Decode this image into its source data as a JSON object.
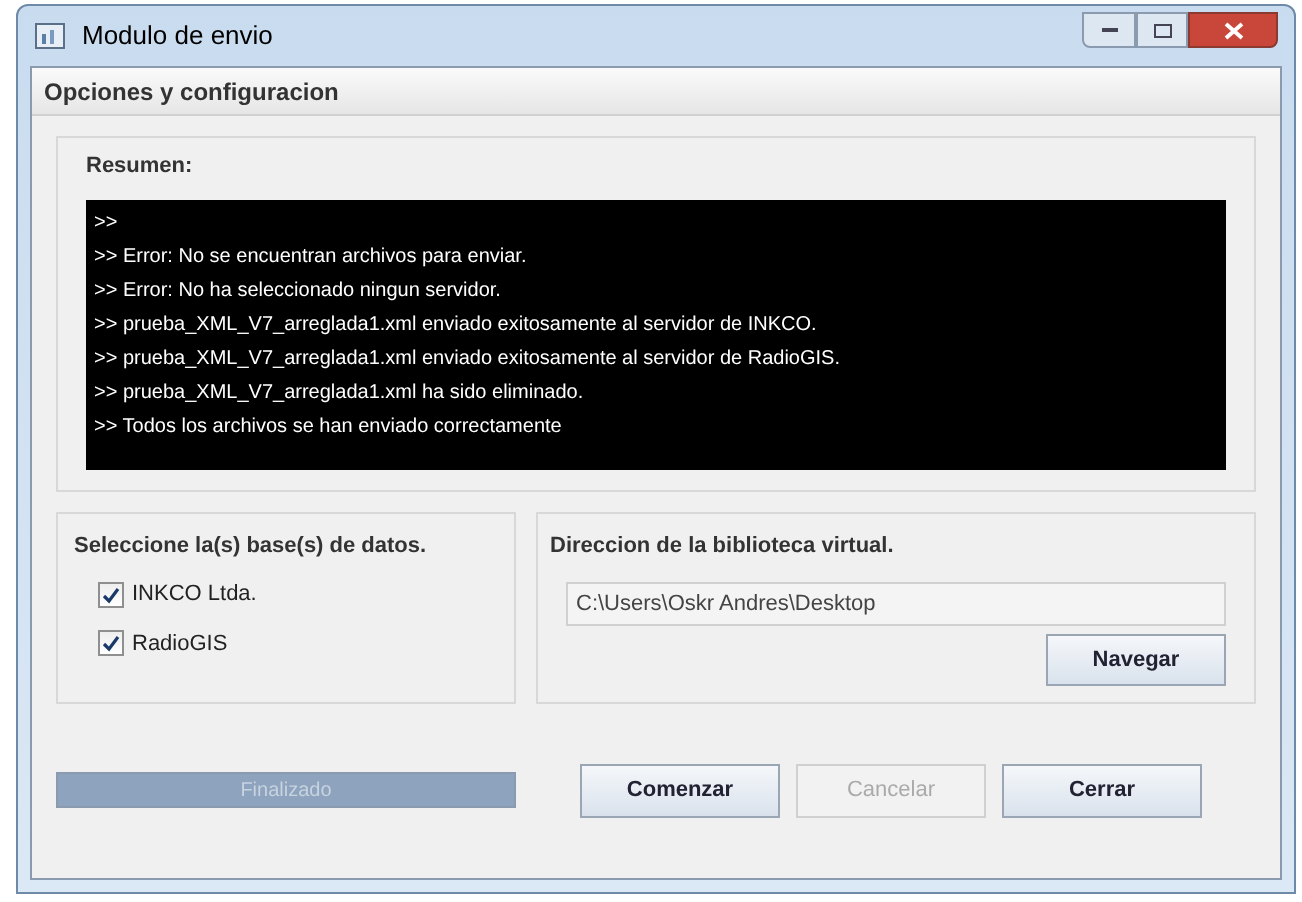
{
  "window": {
    "title": "Modulo de envio"
  },
  "header": "Opciones y configuracion",
  "summary": {
    "title": "Resumen:",
    "lines": [
      ">>",
      ">> Error: No se encuentran archivos para enviar.",
      ">> Error: No ha seleccionado ningun servidor.",
      ">> prueba_XML_V7_arreglada1.xml enviado exitosamente al servidor de INKCO.",
      ">> prueba_XML_V7_arreglada1.xml enviado exitosamente al servidor de RadioGIS.",
      ">> prueba_XML_V7_arreglada1.xml ha sido eliminado.",
      ">> Todos los archivos se han enviado correctamente"
    ]
  },
  "databases": {
    "title": "Seleccione la(s) base(s) de datos.",
    "items": [
      {
        "label": "INKCO Ltda.",
        "checked": true
      },
      {
        "label": "RadioGIS",
        "checked": true
      }
    ]
  },
  "library": {
    "title": "Direccion de la biblioteca virtual.",
    "path": "C:\\Users\\Oskr Andres\\Desktop",
    "button": "Navegar"
  },
  "progress": {
    "label": "Finalizado",
    "level": 1
  },
  "buttons": [
    {
      "label": "Comenzar",
      "disabled": false
    },
    {
      "label": "Cancelar",
      "disabled": true
    },
    {
      "label": "Cerrar",
      "disabled": false
    }
  ]
}
